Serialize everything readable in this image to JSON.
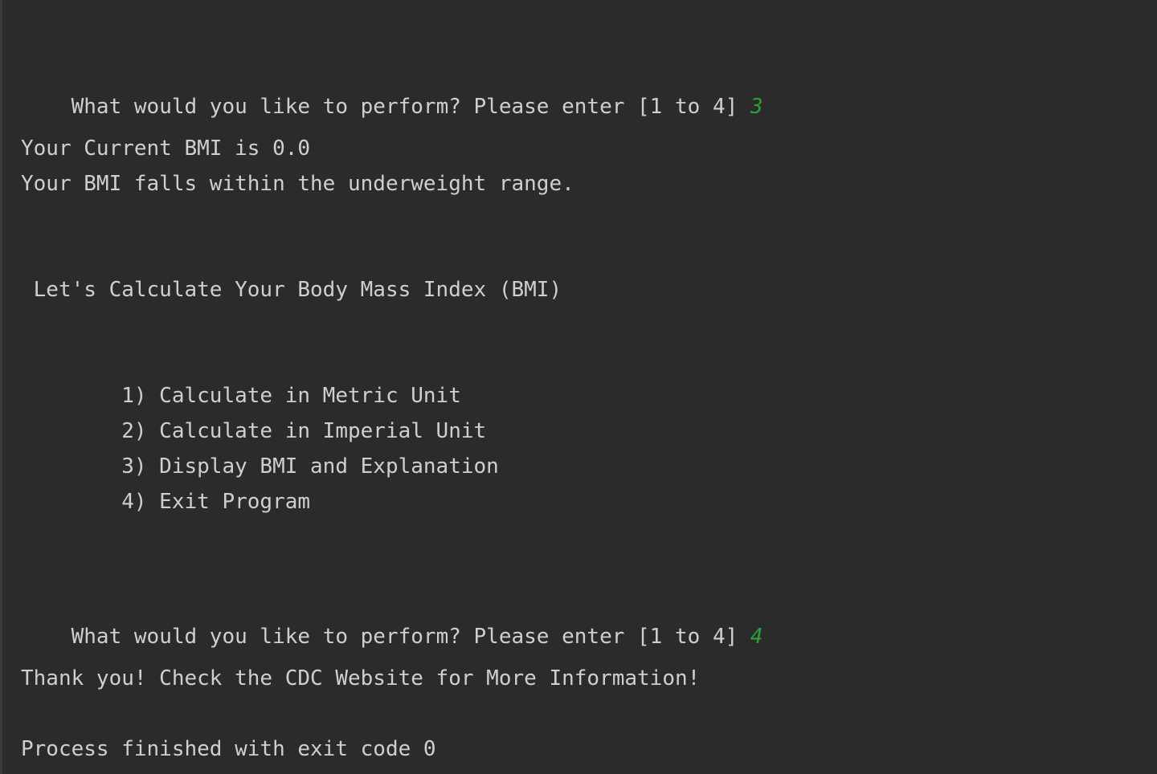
{
  "theme": {
    "background": "#2b2b2b",
    "text_color": "#cfcfcf",
    "user_input_color": "#2e9e3a"
  },
  "console": {
    "prompt_1": {
      "text": "What would you like to perform? Please enter [1 to 4] ",
      "input": "3"
    },
    "bmi_current": "Your Current BMI is 0.0",
    "bmi_range": "Your BMI falls within the underweight range.",
    "heading": " Let's Calculate Your Body Mass Index (BMI)",
    "menu": [
      "        1) Calculate in Metric Unit",
      "        2) Calculate in Imperial Unit",
      "        3) Display BMI and Explanation",
      "        4) Exit Program"
    ],
    "prompt_2": {
      "text": "What would you like to perform? Please enter [1 to 4] ",
      "input": "4"
    },
    "thank_you": "Thank you! Check the CDC Website for More Information!",
    "exit_message": "Process finished with exit code 0"
  }
}
